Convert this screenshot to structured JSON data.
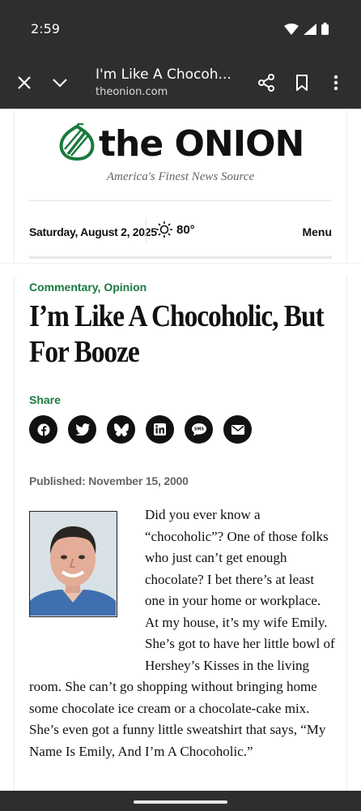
{
  "status_bar": {
    "time": "2:59"
  },
  "browser": {
    "tab_title": "I'm Like A Chocoh...",
    "url": "theonion.com"
  },
  "masthead": {
    "logo_text": "the ONION",
    "tagline": "America's Finest News Source",
    "date": "Saturday, August 2, 2025",
    "temperature": "80°",
    "menu_label": "Menu"
  },
  "article": {
    "category": "Commentary, Opinion",
    "headline": "I’m Like A Chocoholic, But For Booze",
    "share_label": "Share",
    "share_icons": [
      "facebook-icon",
      "twitter-icon",
      "bluesky-icon",
      "linkedin-icon",
      "sms-icon",
      "email-icon"
    ],
    "published_label": "Published:",
    "published_date": "November 15, 2000",
    "body": "Did you ever know a “chocoholic”? One of those folks who just can’t get enough chocolate? I bet there’s at least one in your home or workplace. At my house, it’s my wife Emily. She’s got to have her little bowl of Hershey’s Kisses in the living room. She can’t go shopping without bringing home some chocolate ice cream or a chocolate-cake mix. She’s even got a funny little sweatshirt that says, “My Name Is Emily, And I’m A Chocoholic.”"
  },
  "colors": {
    "brand_green": "#1a7a3c",
    "chrome": "#2d2e30"
  }
}
